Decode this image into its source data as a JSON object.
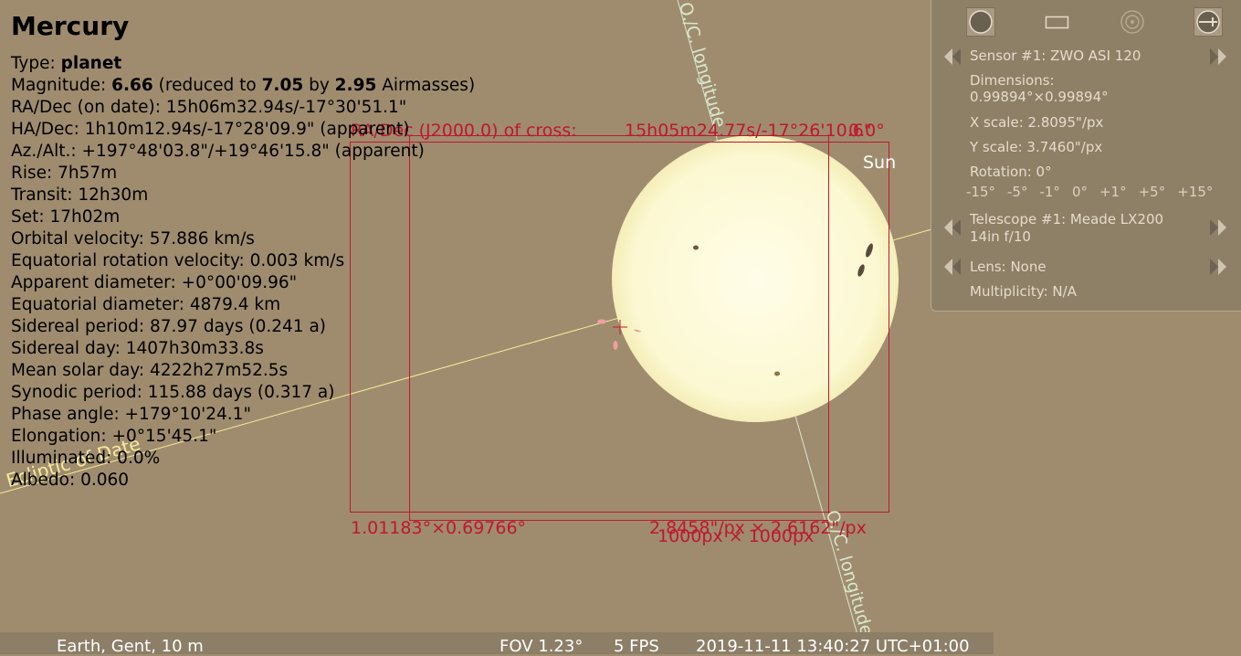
{
  "info": {
    "title": "Mercury",
    "type_label": "Type: ",
    "type_value": "planet",
    "magnitude_label": "Magnitude: ",
    "magnitude_value": "6.66",
    "magnitude_mid": " (reduced to ",
    "magnitude_reduced": "7.05",
    "magnitude_by": " by ",
    "magnitude_airmass": "2.95",
    "magnitude_end": " Airmasses)",
    "lines": [
      "RA/Dec (on date): 15h06m32.94s/-17°30'51.1\"",
      "HA/Dec: 1h10m12.94s/-17°28'09.9\" (apparent)",
      "Az./Alt.: +197°48'03.8\"/+19°46'15.8\" (apparent)",
      "Rise: 7h57m",
      "Transit: 12h30m",
      "Set: 17h02m",
      "Orbital velocity: 57.886 km/s",
      "Equatorial rotation velocity: 0.003 km/s",
      "Apparent diameter: +0°00'09.96\"",
      "Equatorial diameter: 4879.4 km",
      "Sidereal period: 87.97 days (0.241 a)",
      "Sidereal day: 1407h30m33.8s",
      "Mean solar day: 4222h27m52.5s",
      "Synodic period: 115.88 days (0.317 a)",
      "Phase angle: +179°10'24.1\"",
      "Elongation: +0°15'45.1\"",
      "Illuminated: 0.0%",
      "Albedo: 0.060"
    ]
  },
  "ocular": {
    "radec_label": "RA/Dec (J2000.0) of cross:",
    "radec_value": "15h05m24.77s/-17°26'10.6\"",
    "rotation_value": "0.0°",
    "fov_size": "1.01183°×0.69766°",
    "scale": "2.8458\"/px × 2.6162\"/px",
    "resolution": "1000px × 1000px"
  },
  "sky": {
    "sun_label": "Sun",
    "ecliptic_label": "Ecliptic of Date",
    "oc_label": "O./C. longitude"
  },
  "panel": {
    "sensor": "Sensor #1: ZWO ASI 120",
    "dimensions_label": "Dimensions:",
    "dimensions_value": "0.99894°×0.99894°",
    "x_scale": "X scale: 2.8095\"/px",
    "y_scale": "Y scale: 3.7460\"/px",
    "rotation": "Rotation: 0°",
    "rotation_steps": [
      "-15°",
      "-5°",
      "-1°",
      "0°",
      "+1°",
      "+5°",
      "+15°"
    ],
    "telescope_line1": "Telescope #1: Meade  LX200",
    "telescope_line2": "14in f/10",
    "lens": "Lens: None",
    "multiplicity": "Multiplicity: N/A",
    "tool_icons": [
      "ocular-view-icon",
      "sensor-frame-icon",
      "telrad-icon",
      "configure-icon"
    ]
  },
  "status": {
    "location": "Earth, Gent, 10 m",
    "fov": "FOV 1.23°",
    "fps": "5 FPS",
    "datetime": "2019-11-11 13:40:27 UTC+01:00"
  },
  "colors": {
    "sky_background": "#9f8c6e",
    "sun": "#fdfbe0",
    "ccd_frame": "#c0172f",
    "ecliptic_line": "#f6ec99",
    "panel_text": "#e6dccb"
  }
}
